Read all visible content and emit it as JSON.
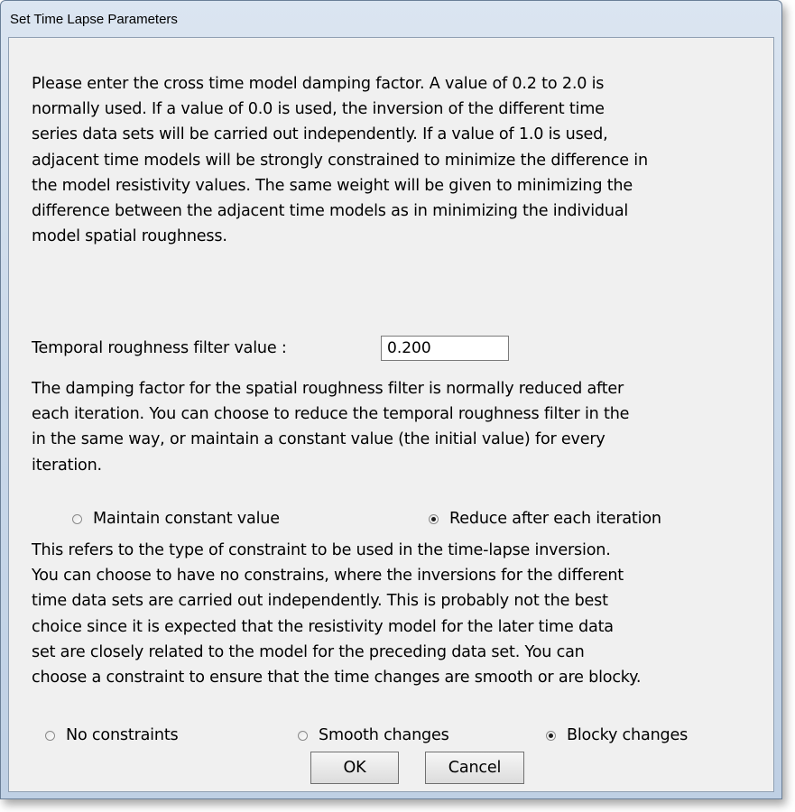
{
  "window": {
    "title": "Set Time Lapse Parameters"
  },
  "intro_text": "Please enter the cross time model damping factor. A value of 0.2 to 2.0 is\nnormally used. If a value of 0.0 is used, the inversion of the different time\nseries data sets will be carried out independently. If a value of 1.0 is used,\nadjacent time models will be strongly constrained to minimize the difference in\nthe model resistivity values. The same weight will be given to minimizing the\ndifference between the adjacent time models as in minimizing the individual\nmodel spatial roughness.",
  "temporal_filter": {
    "label": "Temporal roughness filter value  :",
    "value": "0.200"
  },
  "damping_text": "The damping factor for the spatial roughness filter is normally reduced after\neach iteration. You can choose to reduce the temporal roughness filter in the\nin the same way, or maintain a constant value (the initial value) for every\niteration.",
  "damping_options": [
    {
      "label": "Maintain constant value",
      "checked": false
    },
    {
      "label": "Reduce after each iteration",
      "checked": true
    }
  ],
  "constraint_text": "This refers to the type of constraint to be used in the time-lapse inversion.\nYou can choose to have no constrains, where the inversions for the different\ntime data sets are carried out independently. This is probably not the best\nchoice since it is expected that the resistivity model for the later time data\nset are closely related to the model for the preceding data set. You can\nchoose a constraint to ensure that the time changes are smooth or are blocky.",
  "constraint_options": [
    {
      "label": "No constraints",
      "checked": false
    },
    {
      "label": "Smooth changes",
      "checked": false
    },
    {
      "label": "Blocky changes",
      "checked": true
    }
  ],
  "buttons": {
    "ok": "OK",
    "cancel": "Cancel"
  }
}
